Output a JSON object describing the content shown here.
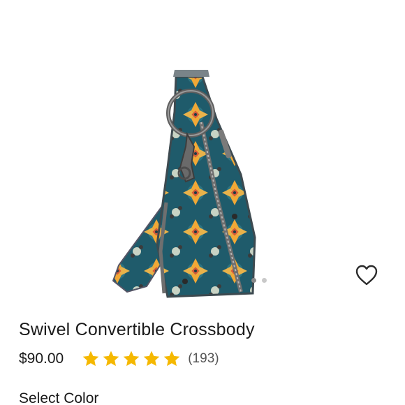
{
  "product": {
    "title": "Swivel Convertible Crossbody",
    "price": "$90.00",
    "rating": 5,
    "rating_max": 5,
    "review_count": "(193)",
    "image_icon": "bag-image",
    "wishlist_icon": "heart-outline-icon"
  },
  "gallery": {
    "slide_count": 2,
    "active_slide": 1
  },
  "options": {
    "select_color_label": "Select Color"
  },
  "colors": {
    "star": "#f5b800",
    "bag_teal": "#1f5b6b",
    "bag_yellow": "#f1a836",
    "bag_red": "#d45b3a"
  }
}
